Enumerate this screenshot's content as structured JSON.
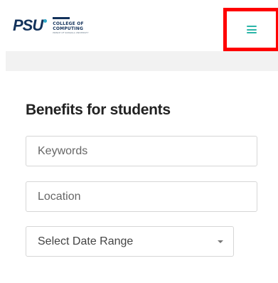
{
  "header": {
    "logo": {
      "mark": "PSU",
      "line1": "COLLEGE OF",
      "line2": "COMPUTING",
      "sub": "PRINCE OF SONGKLA UNIVERSITY"
    },
    "menu_icon": "hamburger-menu-icon",
    "highlight_color": "#ff0000",
    "accent_color": "#2bb5a8"
  },
  "main": {
    "title": "Benefits for students",
    "keywords_placeholder": "Keywords",
    "location_placeholder": "Location",
    "date_range_label": "Select Date Range"
  }
}
